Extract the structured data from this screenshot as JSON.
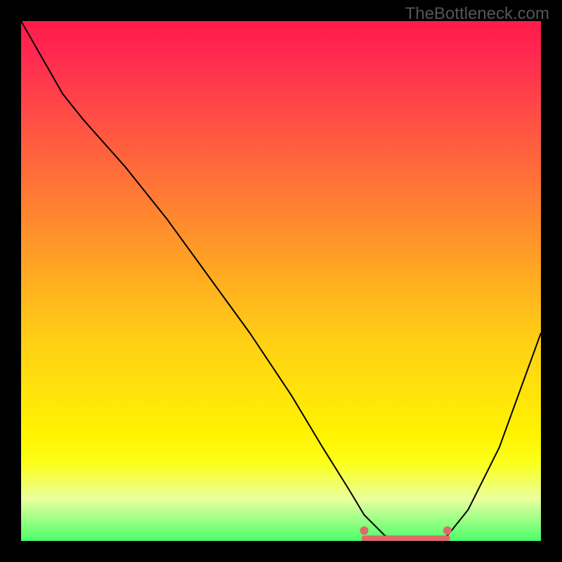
{
  "watermark": "TheBottleneck.com",
  "chart_data": {
    "type": "line",
    "title": "",
    "xlabel": "",
    "ylabel": "",
    "xlim": [
      0,
      100
    ],
    "ylim": [
      0,
      100
    ],
    "series": [
      {
        "name": "curve",
        "x": [
          0,
          4,
          8,
          12,
          20,
          28,
          36,
          44,
          52,
          58,
          63,
          66,
          70,
          74,
          78,
          82,
          86,
          92,
          100
        ],
        "y": [
          100,
          93,
          86,
          81,
          72,
          62,
          51,
          40,
          28,
          18,
          10,
          5,
          1,
          0,
          0,
          1,
          6,
          18,
          40
        ]
      }
    ],
    "flat_region": {
      "x_start": 66,
      "x_end": 82,
      "y": 0.5
    },
    "markers": [
      {
        "x": 66,
        "y": 2
      },
      {
        "x": 82,
        "y": 2
      }
    ],
    "background_gradient": {
      "stops": [
        {
          "pos": 0,
          "color": "#ff1a4a"
        },
        {
          "pos": 50,
          "color": "#ffb400"
        },
        {
          "pos": 85,
          "color": "#fcff1a"
        },
        {
          "pos": 100,
          "color": "#4aff6a"
        }
      ]
    }
  }
}
